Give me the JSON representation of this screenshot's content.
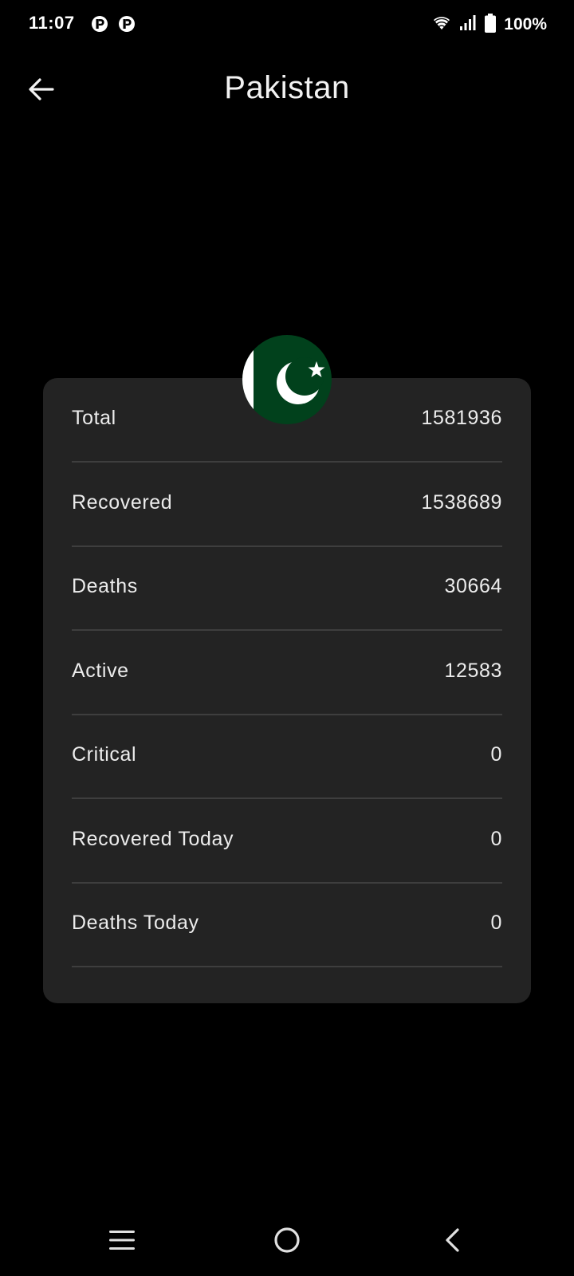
{
  "status_bar": {
    "time": "11:07",
    "battery": "100%",
    "icons": [
      "notification-icon",
      "notification-icon",
      "wifi-icon",
      "signal-icon",
      "battery-icon"
    ]
  },
  "app_bar": {
    "title": "Pakistan",
    "back_icon": "arrow-left-icon"
  },
  "flag": {
    "country": "Pakistan",
    "green": "#01411c",
    "white": "#ffffff"
  },
  "stats": [
    {
      "label": "Total",
      "value": "1581936"
    },
    {
      "label": "Recovered",
      "value": "1538689"
    },
    {
      "label": "Deaths",
      "value": "30664"
    },
    {
      "label": "Active",
      "value": "12583"
    },
    {
      "label": "Critical",
      "value": "0"
    },
    {
      "label": "Recovered Today",
      "value": "0"
    },
    {
      "label": "Deaths Today",
      "value": "0"
    }
  ],
  "colors": {
    "background": "#000000",
    "card": "#232323",
    "divider": "#3e3e3e",
    "text": "#ececec"
  },
  "nav_bar": {
    "icons": [
      "menu-icon",
      "home-icon",
      "back-icon"
    ]
  }
}
